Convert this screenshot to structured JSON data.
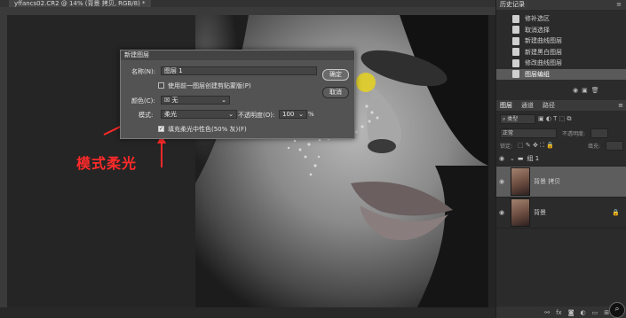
{
  "document": {
    "tab_title": "yffancs02.CR2 @ 14% (背景 拷贝, RGB/8) *"
  },
  "dialog": {
    "title": "新建图层",
    "name_label": "名称(N):",
    "name_value": "图层 1",
    "clip_checkbox_label": "使用前一图层创建剪贴蒙版(P)",
    "color_label": "颜色(C):",
    "color_value": "无",
    "mode_label": "模式:",
    "mode_value": "柔光",
    "opacity_label": "不透明度(O):",
    "opacity_value": "100",
    "opacity_unit": "%",
    "fill_checkbox_label": "填充柔光中性色(50% 灰)(F)",
    "ok_label": "确定",
    "cancel_label": "取消"
  },
  "annotation": {
    "text": "模式柔光",
    "color": "#ff2a2a"
  },
  "history": {
    "title": "历史记录",
    "items": [
      {
        "label": "修补选区"
      },
      {
        "label": "取消选择"
      },
      {
        "label": "新建曲线图层"
      },
      {
        "label": "新建黑白图层"
      },
      {
        "label": "修改曲线图层"
      },
      {
        "label": "图层编组"
      }
    ]
  },
  "layers": {
    "tabs": [
      "图层",
      "通道",
      "路径"
    ],
    "kind_label": "类型",
    "blend_mode": "正常",
    "opacity_label": "不透明度:",
    "fill_label": "填充:",
    "lock_label": "锁定:",
    "rows": [
      {
        "name": "组 1",
        "type": "group"
      },
      {
        "name": "背景 拷贝",
        "type": "layer"
      },
      {
        "name": "背景",
        "type": "layer"
      }
    ]
  },
  "colors": {
    "ui_dark": "#282828",
    "panel": "#2b2b2b",
    "dialog": "#535353",
    "accent_red": "#ff2a2a"
  }
}
